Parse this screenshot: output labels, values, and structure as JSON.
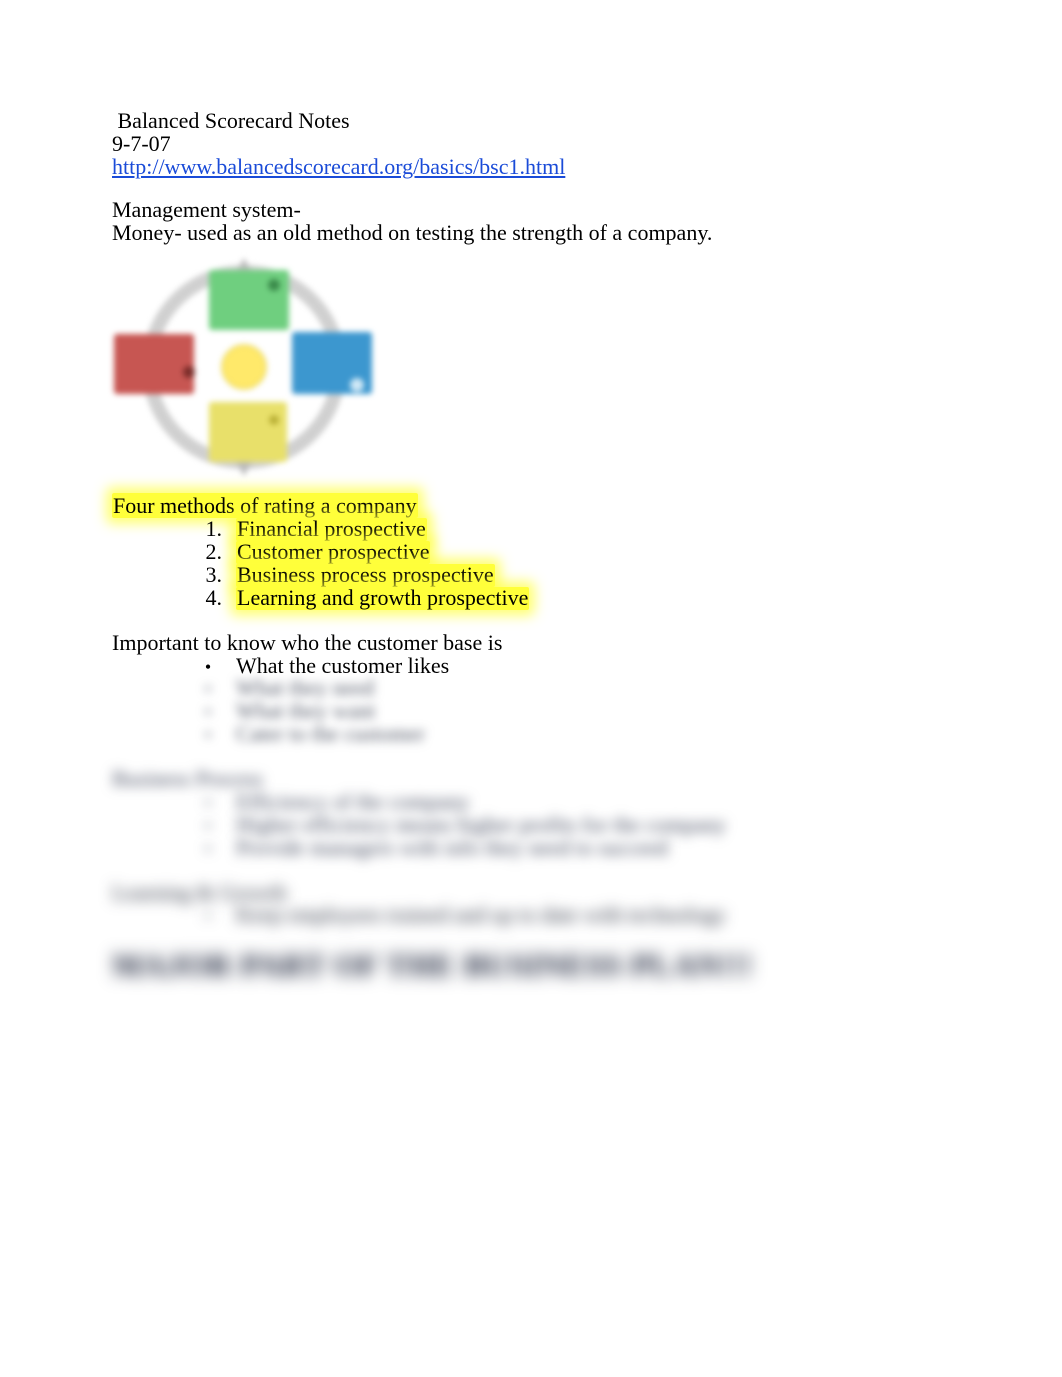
{
  "title": "Balanced Scorecard Notes",
  "date": "9-7-07",
  "url": "http://www.balancedscorecard.org/basics/bsc1.html",
  "mgmt_label": "Management system-",
  "money_line": "Money- used as an old method on testing the strength of a company.",
  "section_four": "Four methods of rating a company",
  "methods": [
    {
      "n": "1.",
      "t": "Financial prospective"
    },
    {
      "n": "2.",
      "t": "Customer prospective"
    },
    {
      "n": "3.",
      "t": "Business process prospective"
    },
    {
      "n": "4.",
      "t": "Learning and growth prospective"
    }
  ],
  "cust_heading": "Important to know who the customer base is",
  "cust_points": [
    "What the customer likes",
    "What they need",
    "What they want",
    "Cater to the customer"
  ],
  "bp_heading": "Business Process",
  "bp_points": [
    "Efficiency of the company",
    "Higher efficiency means higher profits for the company",
    "Provide managers with info they need to succeed"
  ],
  "lg_heading": "Learning & Growth",
  "lg_points": [
    "Keep employees trained and up to date with technology"
  ],
  "footer_big": "MAJOR PART OF THE BUSINESS PLAN!!!"
}
